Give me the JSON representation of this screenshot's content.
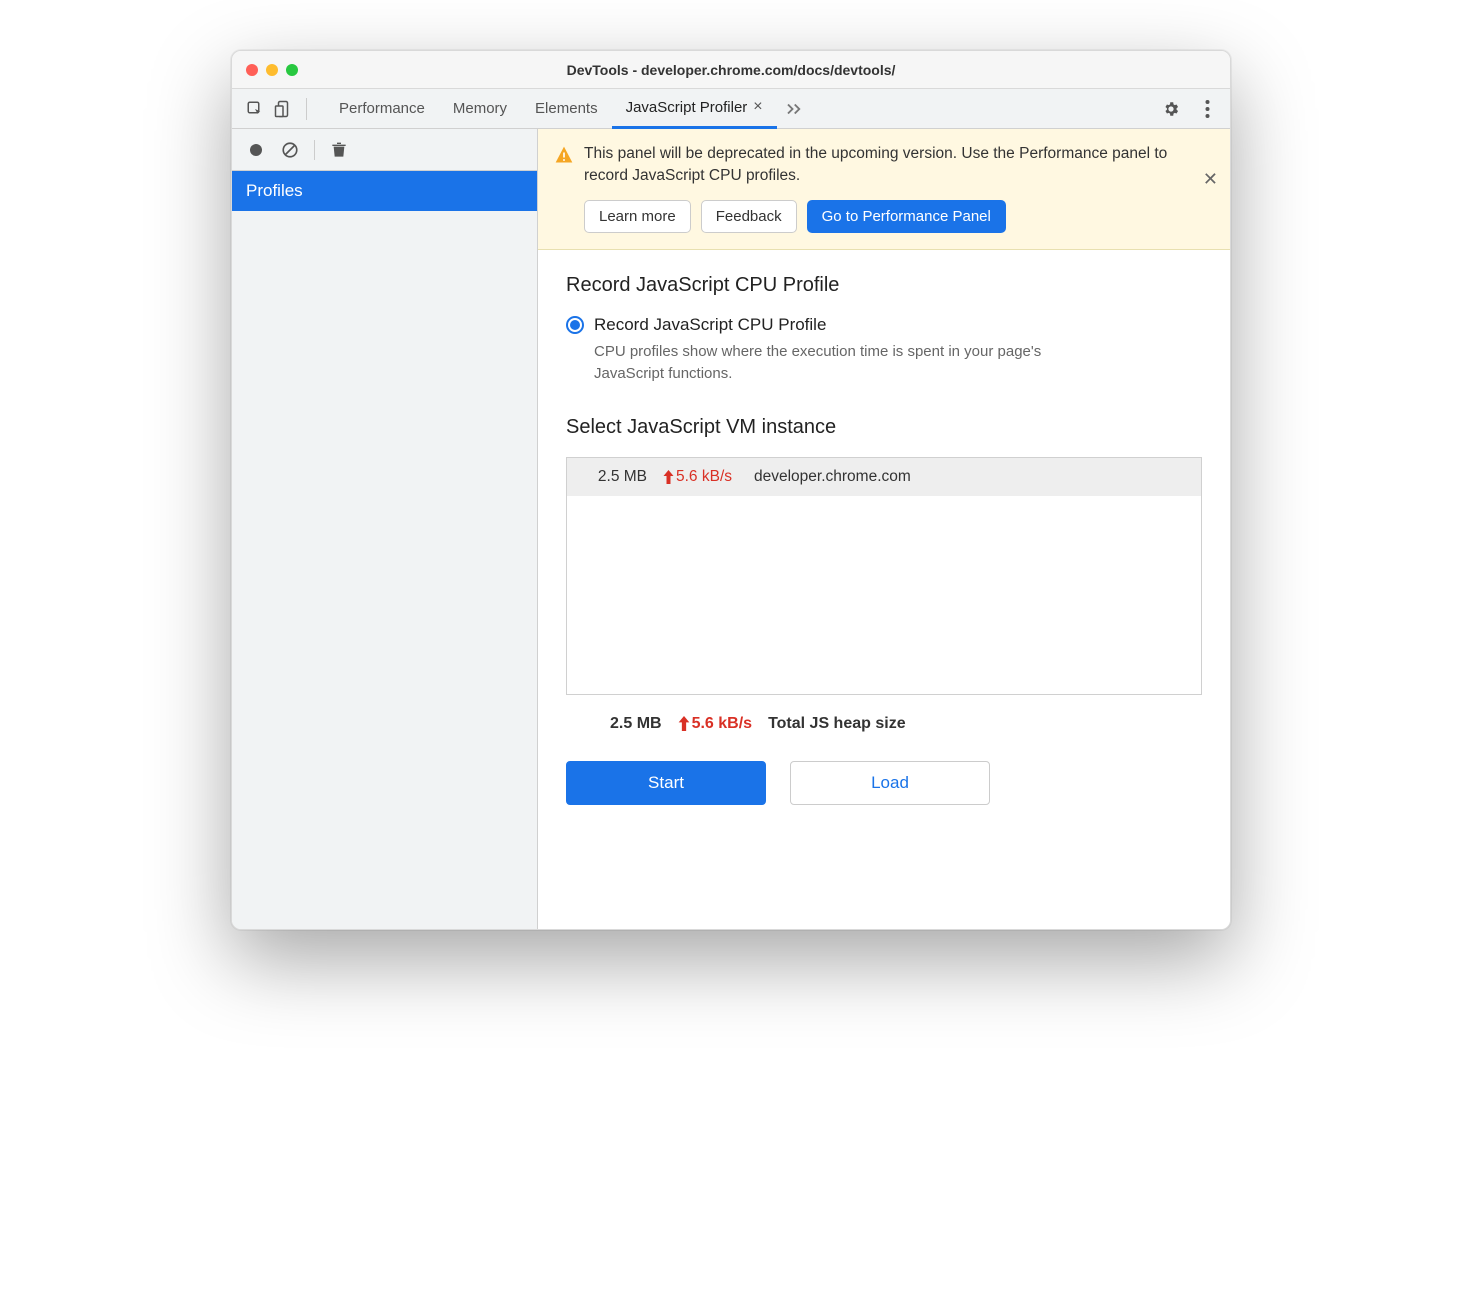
{
  "window": {
    "title": "DevTools - developer.chrome.com/docs/devtools/"
  },
  "tabs": {
    "items": [
      "Performance",
      "Memory",
      "Elements",
      "JavaScript Profiler"
    ],
    "active": "JavaScript Profiler"
  },
  "sidebar": {
    "item_label": "Profiles"
  },
  "banner": {
    "text": "This panel will be deprecated in the upcoming version. Use the Performance panel to record JavaScript CPU profiles.",
    "learn_more": "Learn more",
    "feedback": "Feedback",
    "goto_perf": "Go to Performance Panel"
  },
  "profile": {
    "heading": "Record JavaScript CPU Profile",
    "radio_label": "Record JavaScript CPU Profile",
    "radio_desc": "CPU profiles show where the execution time is spent in your page's JavaScript functions."
  },
  "vm": {
    "heading": "Select JavaScript VM instance",
    "row": {
      "size": "2.5 MB",
      "rate": "5.6 kB/s",
      "host": "developer.chrome.com"
    },
    "summary": {
      "size": "2.5 MB",
      "rate": "5.6 kB/s",
      "label": "Total JS heap size"
    }
  },
  "actions": {
    "start": "Start",
    "load": "Load"
  }
}
